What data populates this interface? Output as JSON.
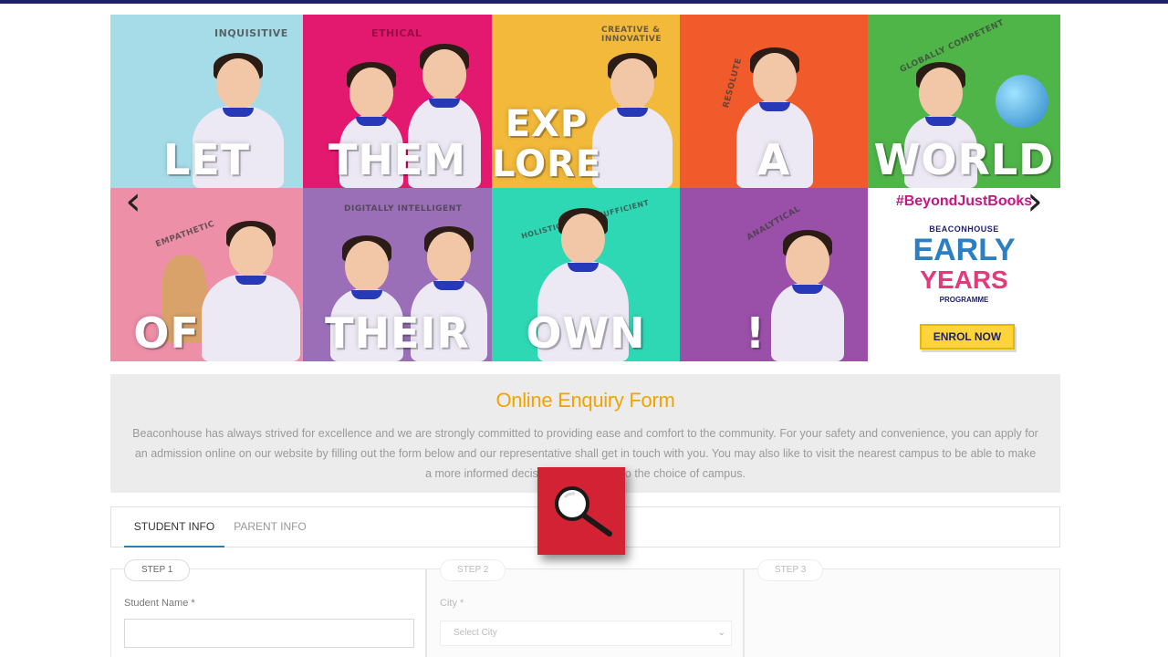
{
  "banner": {
    "tiles": [
      {
        "tag": "INQUISITIVE",
        "word": "LET",
        "color": "#a6dce8"
      },
      {
        "tag": "ETHICAL",
        "word": "THEM",
        "color": "#e3196f"
      },
      {
        "tag": "CREATIVE & INNOVATIVE",
        "word": "EXP LORE",
        "color": "#f2b93a"
      },
      {
        "tag": "RESOLUTE",
        "word": "A",
        "color": "#f15a2a"
      },
      {
        "tag": "GLOBALLY COMPETENT",
        "word": "WORLD",
        "color": "#4fb548"
      },
      {
        "tag": "EMPATHETIC",
        "word": "OF",
        "color": "#ee8fa8"
      },
      {
        "tag": "DIGITALLY INTELLIGENT",
        "word": "THEIR",
        "color": "#9a6fb8"
      },
      {
        "tag": "HOLISTIC & SELF-SUFFICIENT",
        "word": "OWN",
        "color": "#2fd8b4"
      },
      {
        "tag": "ANALYTICAL",
        "word": "!",
        "color": "#9a4fa8"
      }
    ],
    "prev_arrow": "‹",
    "next_arrow": "›",
    "promo": {
      "hashtag": "#BeyondJustBooks",
      "brand": "BEACONHOUSE",
      "early": "EARLY",
      "years": "YEARS",
      "programme": "PROGRAMME",
      "cta": "ENROL NOW"
    }
  },
  "enquiry": {
    "title": "Online Enquiry Form",
    "description": "Beaconhouse has always strived for excellence and we are strongly committed to providing ease and comfort to the community. For your safety and convenience, you can apply for an admission online on our website by filling out the form below and our representative shall get in touch with you. You may also like to visit the nearest campus to be able to make a more informed decision with regards to the choice of campus."
  },
  "tabs": [
    {
      "label": "STUDENT INFO",
      "active": true
    },
    {
      "label": "PARENT INFO",
      "active": false
    }
  ],
  "steps": [
    {
      "label": "STEP 1",
      "field_label": "Student Name *",
      "field_value": ""
    },
    {
      "label": "STEP 2",
      "field_label": "City *",
      "select_value": "Select City"
    },
    {
      "label": "STEP 3"
    }
  ],
  "overlay": {
    "icon": "magnifier-icon"
  },
  "colors": {
    "accent_title": "#f0a400",
    "tab_underline": "#2480b6",
    "overlay_red": "#d32233",
    "hashtag": "#c0197f"
  }
}
